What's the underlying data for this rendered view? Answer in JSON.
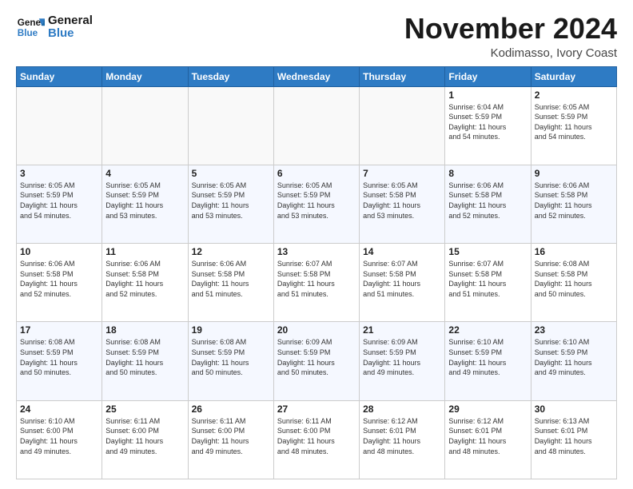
{
  "header": {
    "logo_line1": "General",
    "logo_line2": "Blue",
    "month_title": "November 2024",
    "location": "Kodimasso, Ivory Coast"
  },
  "calendar": {
    "weekdays": [
      "Sunday",
      "Monday",
      "Tuesday",
      "Wednesday",
      "Thursday",
      "Friday",
      "Saturday"
    ],
    "weeks": [
      [
        {
          "day": "",
          "info": ""
        },
        {
          "day": "",
          "info": ""
        },
        {
          "day": "",
          "info": ""
        },
        {
          "day": "",
          "info": ""
        },
        {
          "day": "",
          "info": ""
        },
        {
          "day": "1",
          "info": "Sunrise: 6:04 AM\nSunset: 5:59 PM\nDaylight: 11 hours\nand 54 minutes."
        },
        {
          "day": "2",
          "info": "Sunrise: 6:05 AM\nSunset: 5:59 PM\nDaylight: 11 hours\nand 54 minutes."
        }
      ],
      [
        {
          "day": "3",
          "info": "Sunrise: 6:05 AM\nSunset: 5:59 PM\nDaylight: 11 hours\nand 54 minutes."
        },
        {
          "day": "4",
          "info": "Sunrise: 6:05 AM\nSunset: 5:59 PM\nDaylight: 11 hours\nand 53 minutes."
        },
        {
          "day": "5",
          "info": "Sunrise: 6:05 AM\nSunset: 5:59 PM\nDaylight: 11 hours\nand 53 minutes."
        },
        {
          "day": "6",
          "info": "Sunrise: 6:05 AM\nSunset: 5:59 PM\nDaylight: 11 hours\nand 53 minutes."
        },
        {
          "day": "7",
          "info": "Sunrise: 6:05 AM\nSunset: 5:58 PM\nDaylight: 11 hours\nand 53 minutes."
        },
        {
          "day": "8",
          "info": "Sunrise: 6:06 AM\nSunset: 5:58 PM\nDaylight: 11 hours\nand 52 minutes."
        },
        {
          "day": "9",
          "info": "Sunrise: 6:06 AM\nSunset: 5:58 PM\nDaylight: 11 hours\nand 52 minutes."
        }
      ],
      [
        {
          "day": "10",
          "info": "Sunrise: 6:06 AM\nSunset: 5:58 PM\nDaylight: 11 hours\nand 52 minutes."
        },
        {
          "day": "11",
          "info": "Sunrise: 6:06 AM\nSunset: 5:58 PM\nDaylight: 11 hours\nand 52 minutes."
        },
        {
          "day": "12",
          "info": "Sunrise: 6:06 AM\nSunset: 5:58 PM\nDaylight: 11 hours\nand 51 minutes."
        },
        {
          "day": "13",
          "info": "Sunrise: 6:07 AM\nSunset: 5:58 PM\nDaylight: 11 hours\nand 51 minutes."
        },
        {
          "day": "14",
          "info": "Sunrise: 6:07 AM\nSunset: 5:58 PM\nDaylight: 11 hours\nand 51 minutes."
        },
        {
          "day": "15",
          "info": "Sunrise: 6:07 AM\nSunset: 5:58 PM\nDaylight: 11 hours\nand 51 minutes."
        },
        {
          "day": "16",
          "info": "Sunrise: 6:08 AM\nSunset: 5:58 PM\nDaylight: 11 hours\nand 50 minutes."
        }
      ],
      [
        {
          "day": "17",
          "info": "Sunrise: 6:08 AM\nSunset: 5:59 PM\nDaylight: 11 hours\nand 50 minutes."
        },
        {
          "day": "18",
          "info": "Sunrise: 6:08 AM\nSunset: 5:59 PM\nDaylight: 11 hours\nand 50 minutes."
        },
        {
          "day": "19",
          "info": "Sunrise: 6:08 AM\nSunset: 5:59 PM\nDaylight: 11 hours\nand 50 minutes."
        },
        {
          "day": "20",
          "info": "Sunrise: 6:09 AM\nSunset: 5:59 PM\nDaylight: 11 hours\nand 50 minutes."
        },
        {
          "day": "21",
          "info": "Sunrise: 6:09 AM\nSunset: 5:59 PM\nDaylight: 11 hours\nand 49 minutes."
        },
        {
          "day": "22",
          "info": "Sunrise: 6:10 AM\nSunset: 5:59 PM\nDaylight: 11 hours\nand 49 minutes."
        },
        {
          "day": "23",
          "info": "Sunrise: 6:10 AM\nSunset: 5:59 PM\nDaylight: 11 hours\nand 49 minutes."
        }
      ],
      [
        {
          "day": "24",
          "info": "Sunrise: 6:10 AM\nSunset: 6:00 PM\nDaylight: 11 hours\nand 49 minutes."
        },
        {
          "day": "25",
          "info": "Sunrise: 6:11 AM\nSunset: 6:00 PM\nDaylight: 11 hours\nand 49 minutes."
        },
        {
          "day": "26",
          "info": "Sunrise: 6:11 AM\nSunset: 6:00 PM\nDaylight: 11 hours\nand 49 minutes."
        },
        {
          "day": "27",
          "info": "Sunrise: 6:11 AM\nSunset: 6:00 PM\nDaylight: 11 hours\nand 48 minutes."
        },
        {
          "day": "28",
          "info": "Sunrise: 6:12 AM\nSunset: 6:01 PM\nDaylight: 11 hours\nand 48 minutes."
        },
        {
          "day": "29",
          "info": "Sunrise: 6:12 AM\nSunset: 6:01 PM\nDaylight: 11 hours\nand 48 minutes."
        },
        {
          "day": "30",
          "info": "Sunrise: 6:13 AM\nSunset: 6:01 PM\nDaylight: 11 hours\nand 48 minutes."
        }
      ]
    ]
  }
}
